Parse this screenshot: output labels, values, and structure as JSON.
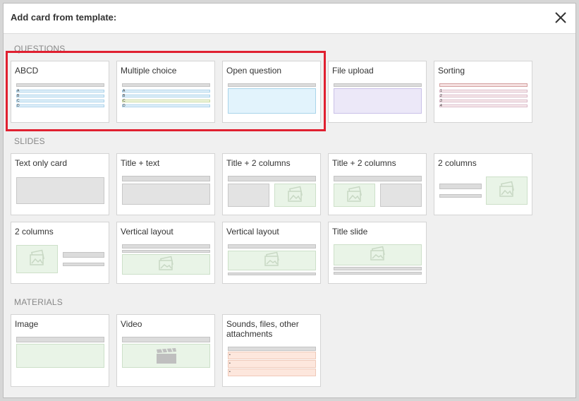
{
  "dialog": {
    "title": "Add card from template:"
  },
  "sections": {
    "questions": "QUESTIONS",
    "slides": "SLIDES",
    "materials": "MATERIALS"
  },
  "questions": [
    "ABCD",
    "Multiple choice",
    "Open question",
    "File upload",
    "Sorting"
  ],
  "slides_row1": [
    "Text only card",
    "Title + text",
    "Title + 2 columns",
    "Title + 2 columns",
    "2 columns"
  ],
  "slides_row2": [
    "2 columns",
    "Vertical layout",
    "Vertical layout",
    "Title slide"
  ],
  "materials": [
    "Image",
    "Video",
    "Sounds, files, other attachments"
  ],
  "abcd_letters": [
    "A",
    "B",
    "C",
    "D"
  ],
  "sorting_numbers": [
    "1",
    "2",
    "3",
    "4"
  ],
  "bullet": "•",
  "icons": {
    "close": "close-icon",
    "image": "image-icon",
    "video": "video-icon"
  },
  "colors": {
    "highlight": "#e02030"
  }
}
